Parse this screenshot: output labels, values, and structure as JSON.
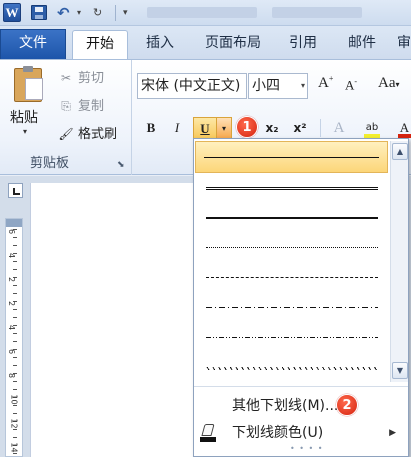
{
  "titlebar": {
    "app_logo": "W",
    "quick_access": {
      "save_icon": "save-icon",
      "undo_glyph": "↶",
      "undo_dropdown_glyph": "▾",
      "redo_glyph": "↻",
      "customize_glyph": "▾"
    }
  },
  "tabs": {
    "file": "文件",
    "home": "开始",
    "insert": "插入",
    "layout": "页面布局",
    "references": "引用",
    "mailings": "邮件",
    "review": "审"
  },
  "clipboard": {
    "paste": "粘贴",
    "paste_arrow": "▾",
    "cut": "剪切",
    "cut_glyph": "✂",
    "copy": "复制",
    "copy_glyph": "⎘",
    "format_painter": "格式刷",
    "format_painter_glyph": "🖌",
    "group_label": "剪贴板",
    "launcher_glyph": "⬊"
  },
  "font": {
    "name": "宋体 (中文正文)",
    "size": "小四",
    "dropdown_glyph": "▾",
    "grow": "A",
    "grow_sup": "+",
    "shrink": "A",
    "shrink_sup": "-",
    "change_case": "Aa",
    "change_case_arrow": "▾",
    "bold": "B",
    "italic": "I",
    "underline": "U",
    "underline_dropdown": "▾",
    "subscript": "x₂",
    "superscript": "x²",
    "text_effects": "A",
    "highlight": "ab",
    "font_color": "A"
  },
  "badges": {
    "first": "1",
    "second": "2"
  },
  "underline_menu": {
    "styles": [
      "single",
      "double",
      "thick",
      "dotted",
      "dash",
      "dash-dot",
      "dash-dot-dot",
      "wave"
    ],
    "selected_index": 0,
    "scroll_up": "▲",
    "scroll_down": "▼",
    "more_underlines": "其他下划线(M)...",
    "underline_color": "下划线颜色(U)",
    "underline_color_swatch": "#111111",
    "submenu_arrow": "▶",
    "grip": "• • • •"
  },
  "ruler": {
    "numbers": [
      "6",
      "4",
      "2",
      "2",
      "4",
      "6",
      "8",
      "10",
      "12",
      "14"
    ]
  },
  "colors": {
    "accent_blue": "#1d55aa",
    "selection_orange": "#fcd679",
    "badge_red": "#d5230f"
  }
}
